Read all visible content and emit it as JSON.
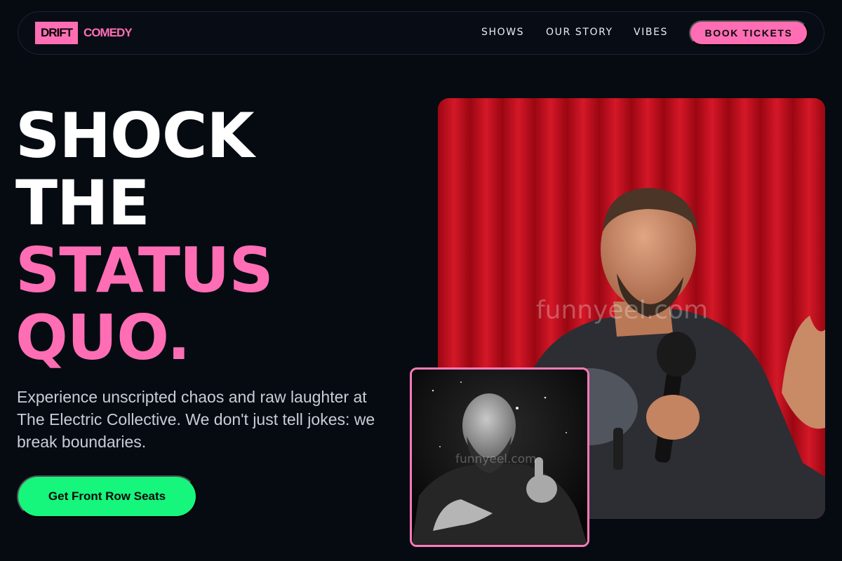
{
  "brand": {
    "box_text": "DRIFT",
    "word": "COMEDY",
    "accent": "#ff6eb4"
  },
  "nav": {
    "links": [
      "SHOWS",
      "OUR STORY",
      "VIBES"
    ],
    "cta": "BOOK TICKETS"
  },
  "hero": {
    "headline_white": [
      "SHOCK",
      "THE"
    ],
    "headline_pink": [
      "STATUS",
      "QUO."
    ],
    "lead": "Experience unscripted chaos and raw laughter at The Electric Collective. We don't just tell jokes: we break boundaries.",
    "cta": "Get Front Row Seats",
    "cta_color": "#16f57c"
  },
  "images": {
    "main": {
      "icon": "comedian-with-microphone-photo",
      "watermark": "funnyeel.com"
    },
    "inset": {
      "icon": "bald-comedian-pointing-photo",
      "watermark": "funnyeel.com"
    }
  }
}
